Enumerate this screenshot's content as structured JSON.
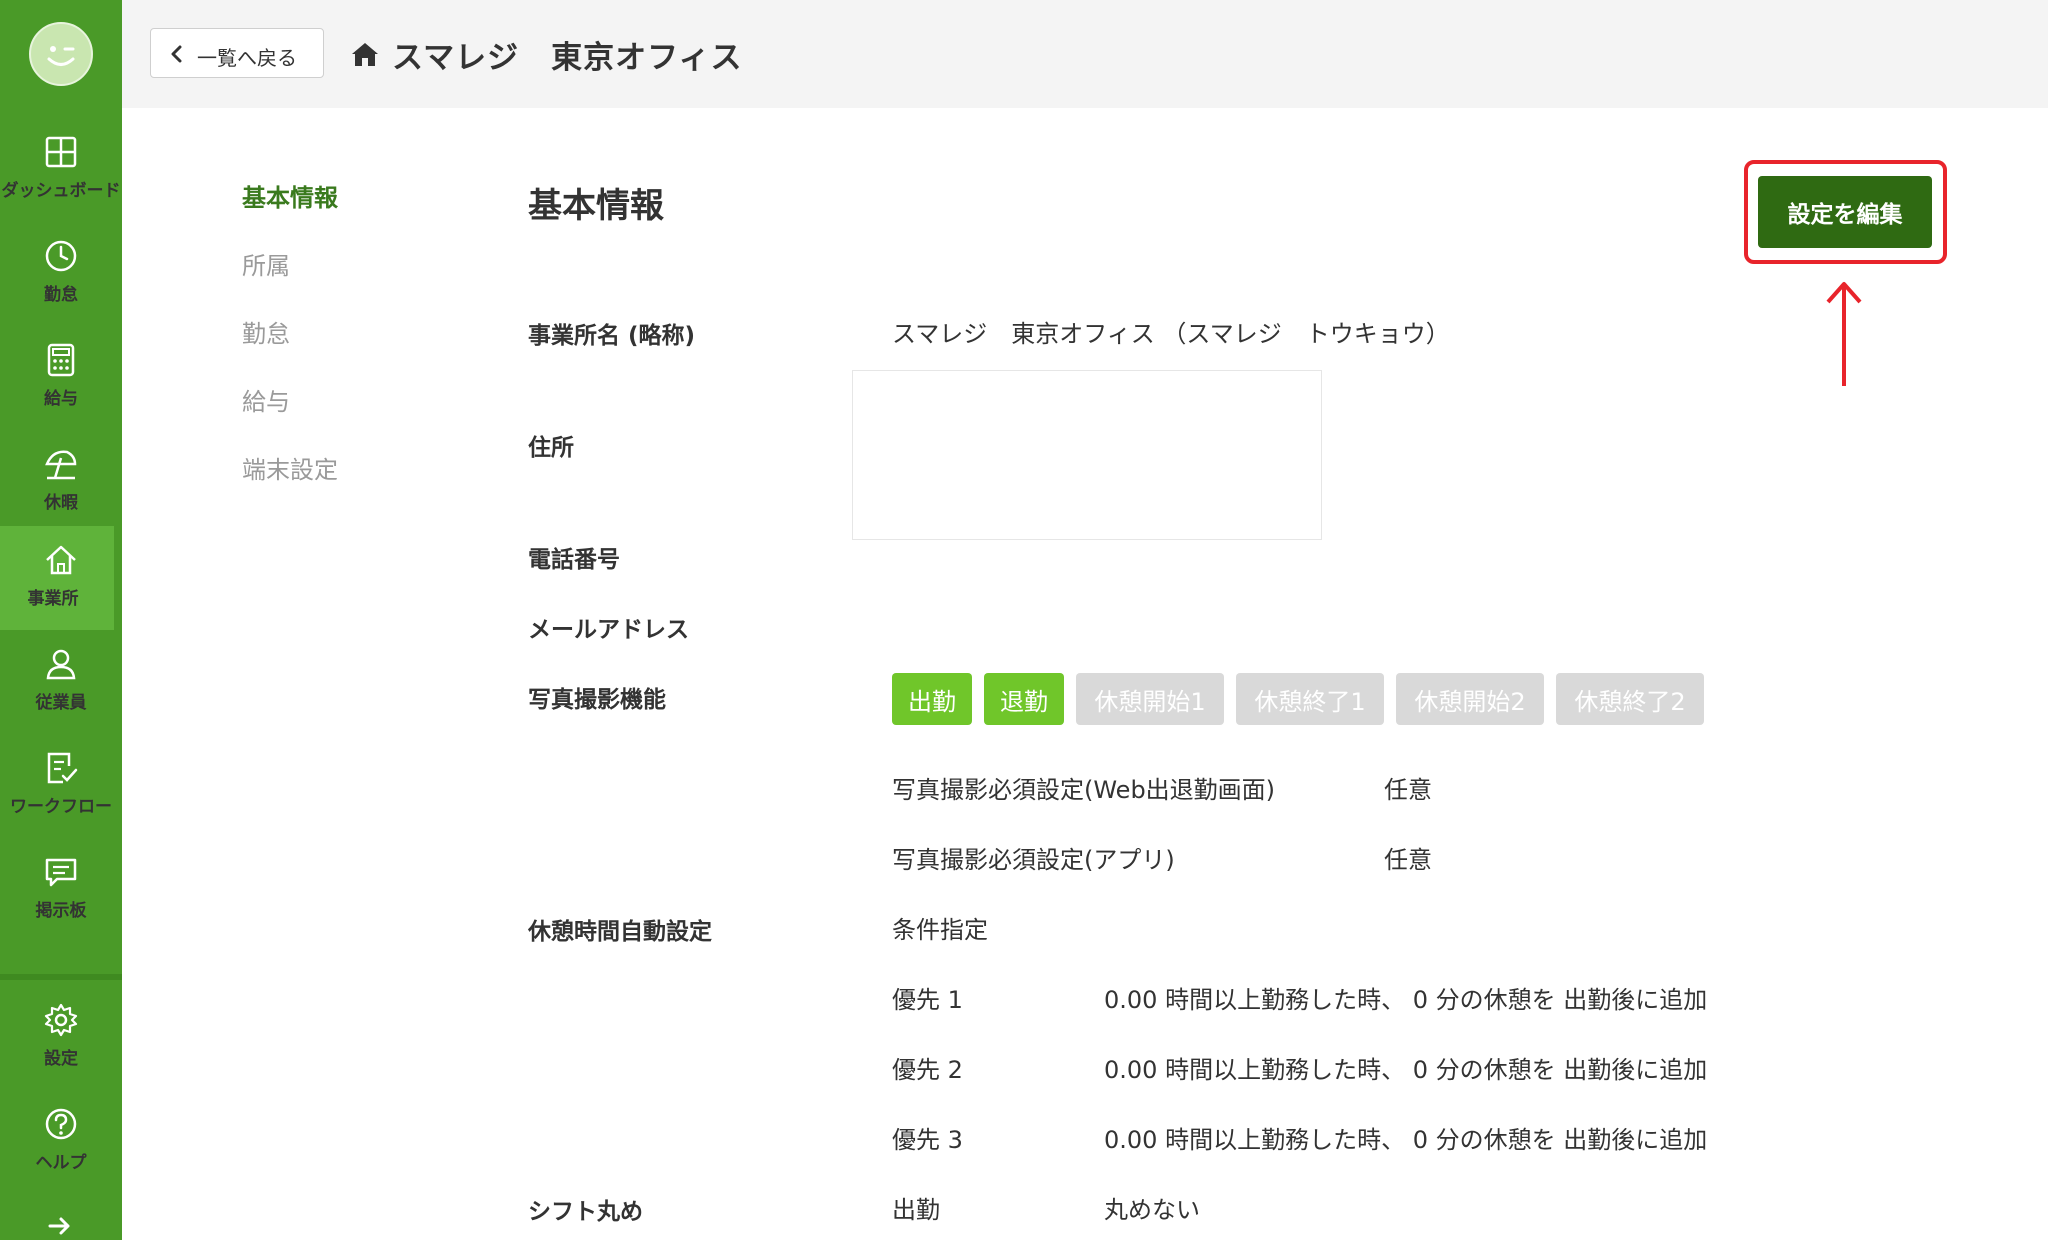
{
  "colors": {
    "sidebar": "#4a9a28",
    "sidebar_active": "#5fb33a",
    "accent": "#2f6a12",
    "tag_on": "#70c62a",
    "tag_off": "#d9d9d9",
    "highlight": "#e8242b"
  },
  "sidebar": {
    "items": [
      {
        "label": "ダッシュボード",
        "icon": "dashboard-icon"
      },
      {
        "label": "勤怠",
        "icon": "clock-icon"
      },
      {
        "label": "給与",
        "icon": "calculator-icon"
      },
      {
        "label": "休暇",
        "icon": "beach-umbrella-icon"
      },
      {
        "label": "事業所",
        "icon": "home-icon"
      },
      {
        "label": "従業員",
        "icon": "person-icon"
      },
      {
        "label": "ワークフロー",
        "icon": "checklist-icon"
      },
      {
        "label": "掲示板",
        "icon": "message-icon"
      },
      {
        "label": "設定",
        "icon": "gear-icon"
      },
      {
        "label": "ヘルプ",
        "icon": "help-icon"
      }
    ]
  },
  "header": {
    "back_label": "一覧へ戻る",
    "store_name": "スマレジ　東京オフィス"
  },
  "subnav": [
    "基本情報",
    "所属",
    "勤怠",
    "給与",
    "端末設定"
  ],
  "main": {
    "section_title": "基本情報",
    "edit_label": "設定を編集",
    "fields": {
      "name_label": "事業所名 (略称)",
      "name_value": "スマレジ　東京オフィス （スマレジ　トウキョウ）",
      "address_label": "住所",
      "phone_label": "電話番号",
      "email_label": "メールアドレス",
      "photo_label": "写真撮影機能",
      "photo_tags": [
        {
          "label": "出勤",
          "active": true
        },
        {
          "label": "退勤",
          "active": true
        },
        {
          "label": "休憩開始1",
          "active": false
        },
        {
          "label": "休憩終了1",
          "active": false
        },
        {
          "label": "休憩開始2",
          "active": false
        },
        {
          "label": "休憩終了2",
          "active": false
        }
      ],
      "photo_web_label": "写真撮影必須設定(Web出退勤画面)",
      "photo_web_value": "任意",
      "photo_app_label": "写真撮影必須設定(アプリ)",
      "photo_app_value": "任意",
      "break_label": "休憩時間自動設定",
      "break_mode": "条件指定",
      "break_rules": [
        {
          "priority": "優先 1",
          "rule": "0.00 時間以上勤務した時、 0 分の休憩を 出勤後に追加"
        },
        {
          "priority": "優先 2",
          "rule": "0.00 時間以上勤務した時、 0 分の休憩を 出勤後に追加"
        },
        {
          "priority": "優先 3",
          "rule": "0.00 時間以上勤務した時、 0 分の休憩を 出勤後に追加"
        }
      ],
      "shift_label": "シフト丸め",
      "shift_type": "出勤",
      "shift_value": "丸めない"
    }
  }
}
